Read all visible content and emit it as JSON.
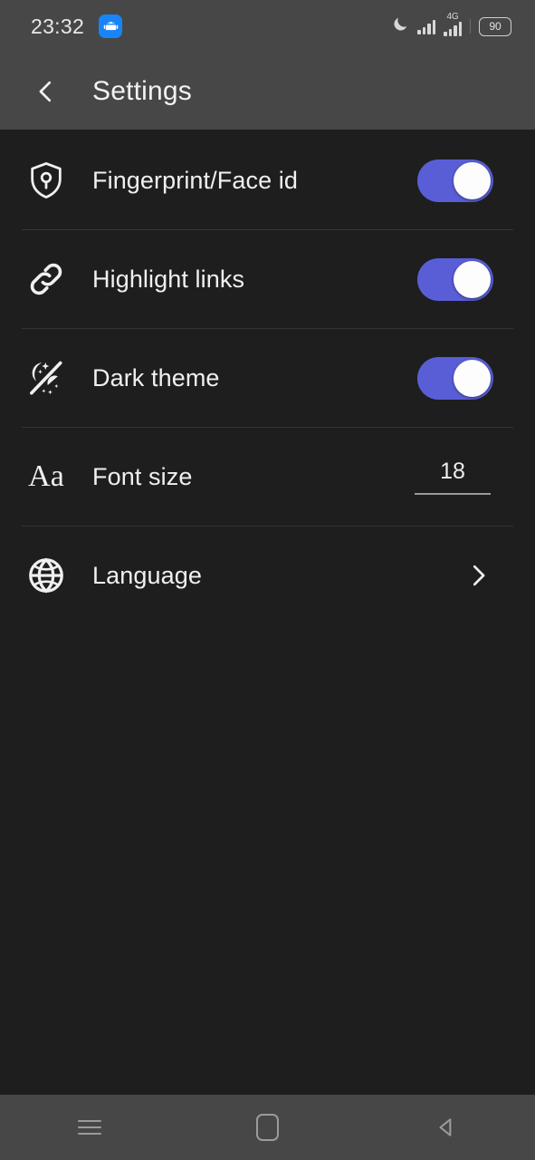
{
  "status_bar": {
    "clock": "23:32",
    "app_icon": "android-robot-icon",
    "dnd_icon": "moon-icon",
    "signal_icon": "signal-bars-icon",
    "network_label": "4G",
    "network_toggle_glyph": "⇅",
    "battery_level": "90"
  },
  "app_bar": {
    "back_icon": "back-chevron-icon",
    "title": "Settings"
  },
  "settings": {
    "rows": [
      {
        "label": "Fingerprint/Face id",
        "icon": "shield-fingerprint-icon",
        "control": "toggle",
        "value": "on"
      },
      {
        "label": "Highlight links",
        "icon": "link-chain-icon",
        "control": "toggle",
        "value": "on"
      },
      {
        "label": "Dark theme",
        "icon": "moon-sun-theme-icon",
        "control": "toggle",
        "value": "on"
      },
      {
        "label": "Font size",
        "icon": "font-size-aa-icon",
        "control": "number-field",
        "value": "18"
      },
      {
        "label": "Language",
        "icon": "globe-icon",
        "control": "chevron",
        "value": ""
      }
    ]
  },
  "nav_bar": {
    "recents_icon": "recents-menu-icon",
    "home_icon": "home-square-icon",
    "back_icon": "back-triangle-icon"
  },
  "colors": {
    "accent": "#5A5ED6",
    "background": "#1E1E1E",
    "bar_background": "#474747",
    "text_primary": "#F0F0F0",
    "divider": "#343434"
  }
}
